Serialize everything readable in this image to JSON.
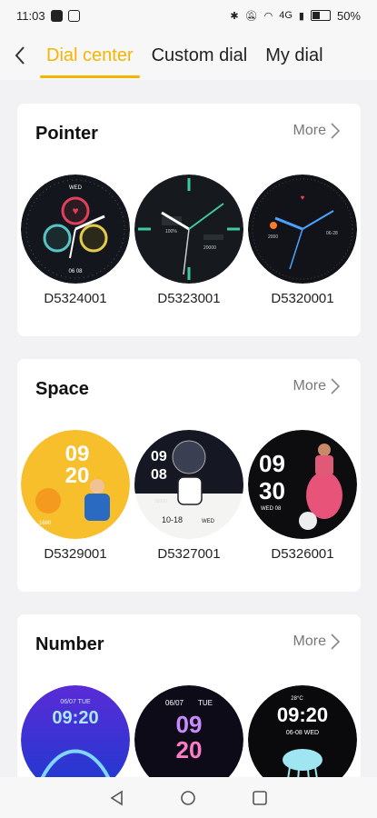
{
  "status": {
    "time": "11:03",
    "network": "4G",
    "battery": "50%"
  },
  "nav": {
    "tabs": [
      {
        "label": "Dial center",
        "active": true
      },
      {
        "label": "Custom dial",
        "active": false
      },
      {
        "label": "My dial",
        "active": false
      }
    ],
    "accent": "#f5b400"
  },
  "sections": [
    {
      "title": "Pointer",
      "more": "More",
      "dials": [
        {
          "id": "D5324001",
          "date": "WED",
          "num": "06 08"
        },
        {
          "id": "D5323001",
          "num": "100%",
          "num2": "20000"
        },
        {
          "id": "D5320001",
          "num": "06-28",
          "num2": "2000"
        }
      ]
    },
    {
      "title": "Space",
      "more": "More",
      "dials": [
        {
          "id": "D5329001",
          "time": [
            "09",
            "20"
          ],
          "num": "1680"
        },
        {
          "id": "D5327001",
          "time": [
            "09",
            "08"
          ],
          "date": "10-18",
          "day": "WED",
          "num": "20000"
        },
        {
          "id": "D5326001",
          "time": [
            "09",
            "30"
          ],
          "day": "WED 08"
        }
      ]
    },
    {
      "title": "Number",
      "more": "More",
      "dials": [
        {
          "date": "06/07 TUE",
          "time": "09:20"
        },
        {
          "date": "06/07",
          "day": "TUE",
          "time": [
            "09",
            "20"
          ]
        },
        {
          "temp": "28°C",
          "time": "09:20",
          "date": "06-08 WED"
        }
      ]
    }
  ]
}
